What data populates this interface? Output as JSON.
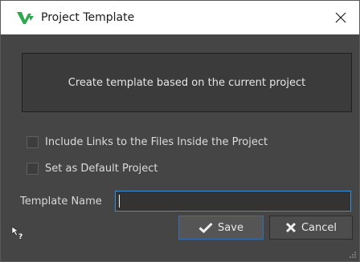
{
  "window": {
    "title": "Project Template",
    "app_icon": "wavelab-logo-icon",
    "close_icon": "close-icon"
  },
  "create_template": {
    "label": "Create template based on the current project"
  },
  "options": [
    {
      "label": "Include Links to the Files Inside the Project",
      "checked": false
    },
    {
      "label": "Set as Default Project",
      "checked": false
    }
  ],
  "template_name": {
    "label": "Template Name",
    "value": ""
  },
  "buttons": {
    "save_label": "Save",
    "save_icon": "checkmark-icon",
    "cancel_label": "Cancel",
    "cancel_icon": "x-icon"
  },
  "footer": {
    "help_icon": "whats-this-help-icon",
    "grip_icon": "resize-grip-icon"
  },
  "colors": {
    "accent": "#3b8fd9",
    "app_icon_green": "#2fa84f"
  }
}
